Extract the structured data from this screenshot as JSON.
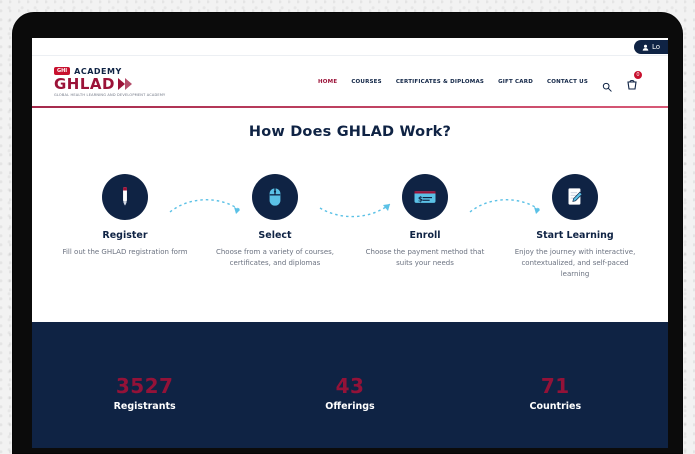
{
  "top_strip": {
    "login_text": "Lo"
  },
  "brand": {
    "badge": "GHI",
    "academy": "ACADEMY",
    "name": "GHLAD",
    "tagline": "GLOBAL HEALTH LEARNING AND DEVELOPMENT ACADEMY"
  },
  "nav": {
    "items": [
      {
        "label": "HOME",
        "active": true
      },
      {
        "label": "COURSES",
        "active": false
      },
      {
        "label": "CERTIFICATES & DIPLOMAS",
        "active": false
      },
      {
        "label": "GIFT CARD",
        "active": false
      },
      {
        "label": "CONTACT US",
        "active": false
      }
    ],
    "search_icon": "search-icon",
    "cart_icon": "cart-icon",
    "cart_count": "0"
  },
  "how_it_works": {
    "title": "How Does GHLAD Work?",
    "steps": [
      {
        "title": "Register",
        "desc": "Fill out the GHLAD registration form",
        "icon": "pencil-icon"
      },
      {
        "title": "Select",
        "desc": "Choose from a variety of courses, certificates, and diplomas",
        "icon": "mouse-icon"
      },
      {
        "title": "Enroll",
        "desc": "Choose the payment method that suits your needs",
        "icon": "check-payment-icon"
      },
      {
        "title": "Start Learning",
        "desc": "Enjoy the journey with interactive, contextualized, and self-paced learning",
        "icon": "document-pen-icon"
      }
    ]
  },
  "stats": [
    {
      "value": "3527",
      "label": "Registrants"
    },
    {
      "value": "43",
      "label": "Offerings"
    },
    {
      "value": "71",
      "label": "Countries"
    }
  ],
  "colors": {
    "navy": "#0f2344",
    "crimson": "#9b1238",
    "red": "#c8102e",
    "arrow": "#5bc1e6"
  }
}
